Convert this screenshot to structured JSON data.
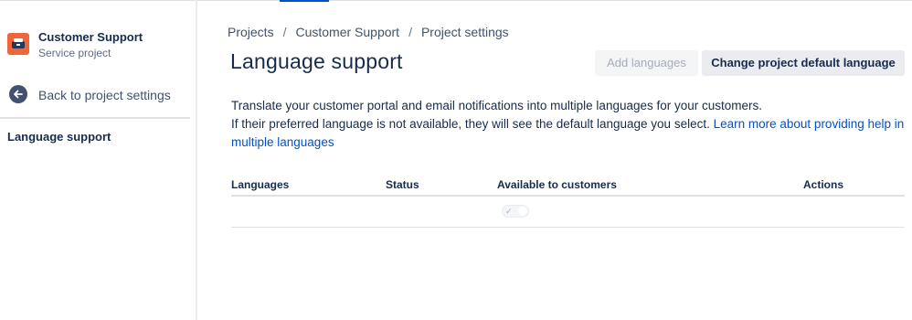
{
  "sidebar": {
    "project_name": "Customer Support",
    "project_type": "Service project",
    "project_icon": "project-avatar-icon",
    "back_label": "Back to project settings",
    "back_icon": "arrow-left-circle-icon",
    "active_item": "Language support"
  },
  "breadcrumb": {
    "items": [
      "Projects",
      "Customer Support",
      "Project settings"
    ],
    "separator": "/"
  },
  "page": {
    "title": "Language support",
    "add_languages_label": "Add languages",
    "change_default_label": "Change project default language",
    "description_line1": "Translate your customer portal and email notifications into multiple languages for your customers.",
    "description_line2": "If their preferred language is not available, they will see the default language you select.",
    "learn_more_link": "Learn more about providing help in multiple languages"
  },
  "table": {
    "headers": [
      "Languages",
      "Status",
      "Available to customers",
      "Actions"
    ],
    "rows": [
      {
        "language": "",
        "status": "",
        "available": true,
        "actions": ""
      }
    ]
  },
  "colors": {
    "accent": "#0052cc",
    "project_avatar": "#f0653a",
    "text": "#172b4d",
    "muted": "#42526e",
    "disabled": "#a5adba"
  }
}
